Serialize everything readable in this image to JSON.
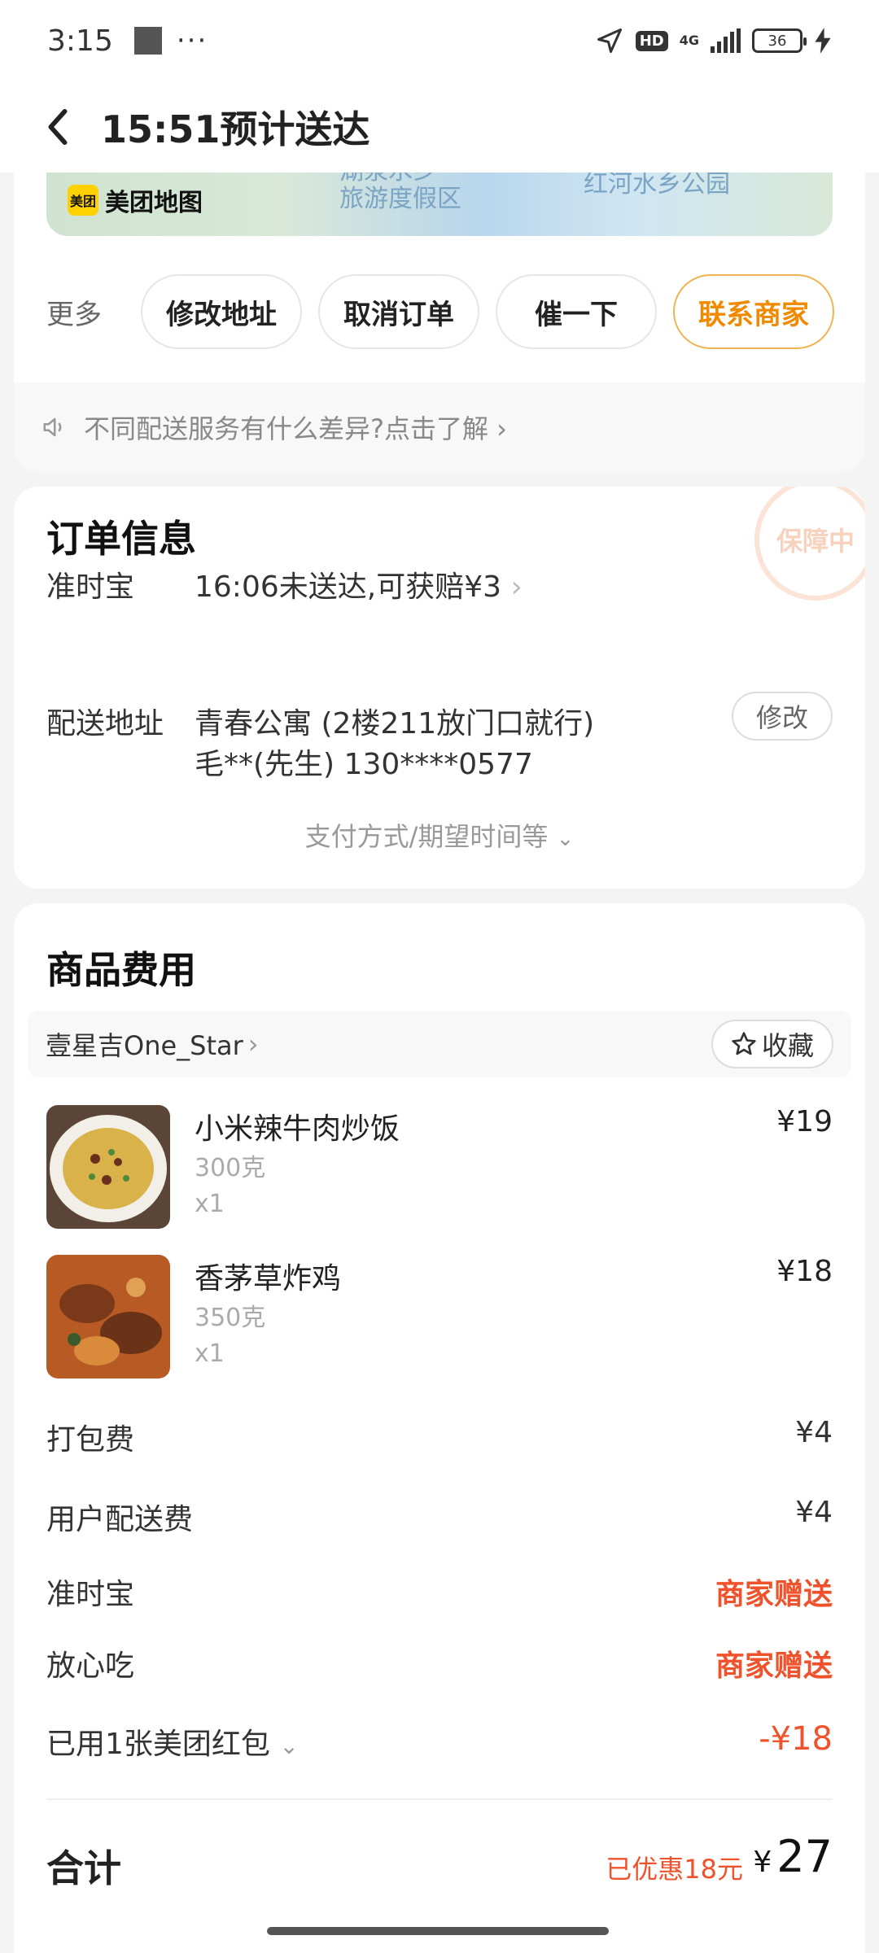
{
  "status": {
    "time": "3:15",
    "dots": "···",
    "network": "4G",
    "hd": "HD",
    "battery": "36"
  },
  "header": {
    "title": "15:51预计送达"
  },
  "map": {
    "logo_badge": "美团",
    "logo_text": "美团地图",
    "poi1": "湖泉水乡\n旅游度假区",
    "poi2": "红河水乡公园"
  },
  "actions": {
    "more": "更多",
    "buttons": [
      "修改地址",
      "取消订单",
      "催一下",
      "联系商家"
    ]
  },
  "notice": {
    "text": "不同配送服务有什么差异?点击了解 ›"
  },
  "order": {
    "title": "订单信息",
    "stamp": "保障中",
    "ontime_label": "准时宝",
    "ontime_value": "16:06未送达,可获赔¥3",
    "address_label": "配送地址",
    "address_line1": "青春公寓 (2楼211放门口就行)",
    "address_line2": "毛**(先生) 130****0577",
    "modify": "修改",
    "pay_toggle": "支付方式/期望时间等"
  },
  "goods": {
    "title": "商品费用",
    "shop_name": "壹星吉One_Star",
    "fav_label": "收藏",
    "items": [
      {
        "name": "小米辣牛肉炒饭",
        "spec": "300克",
        "qty": "x1",
        "price": "¥19"
      },
      {
        "name": "香茅草炸鸡",
        "spec": "350克",
        "qty": "x1",
        "price": "¥18"
      }
    ],
    "fees": [
      {
        "label": "打包费",
        "value": "¥4"
      },
      {
        "label": "用户配送费",
        "value": "¥4"
      },
      {
        "label": "准时宝",
        "value": "商家赠送"
      },
      {
        "label": "放心吃",
        "value": "商家赠送"
      },
      {
        "label": "已用1张美团红包",
        "value": "-¥18"
      }
    ],
    "total_label": "合计",
    "discount": "已优惠18元",
    "total_currency": "¥",
    "total_amount": "27"
  }
}
